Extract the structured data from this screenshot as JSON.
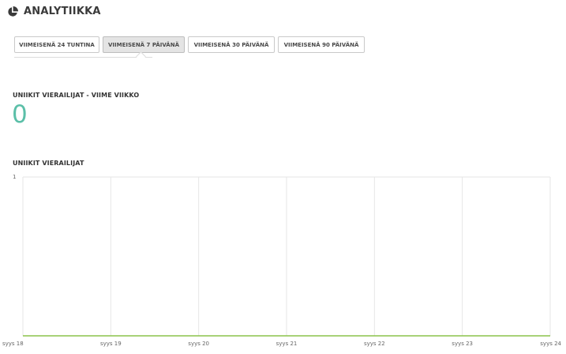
{
  "header": {
    "title": "ANALYTIIKKA",
    "icon": "pie-chart-icon"
  },
  "tabs": [
    {
      "label": "VIIMEISENÄ 24 TUNTINA",
      "active": false
    },
    {
      "label": "VIIMEISENÄ 7 PÄIVÄNÄ",
      "active": true
    },
    {
      "label": "VIIMEISENÄ 30 PÄIVÄNÄ",
      "active": false
    },
    {
      "label": "VIIMEISENÄ 90 PÄIVÄNÄ",
      "active": false
    }
  ],
  "unique_visitors_week": {
    "label": "UNIIKIT VIERAILIJAT - VIIME VIIKKO",
    "value": "0"
  },
  "visitors_chart": {
    "label": "UNIIKIT VIERAILIJAT"
  },
  "colors": {
    "accent": "#5bbfa8",
    "line": "#8bc34a",
    "grid": "#e6e6e6",
    "active_tab_bg": "#e4e4e4"
  },
  "chart_data": {
    "type": "line",
    "categories": [
      "syys 18",
      "syys 19",
      "syys 20",
      "syys 21",
      "syys 22",
      "syys 23",
      "syys 24"
    ],
    "series": [
      {
        "values": [
          0,
          0,
          0,
          0,
          0,
          0,
          0
        ]
      }
    ],
    "ylim": [
      0,
      1
    ],
    "yticks": [
      "1"
    ],
    "grid": true
  }
}
